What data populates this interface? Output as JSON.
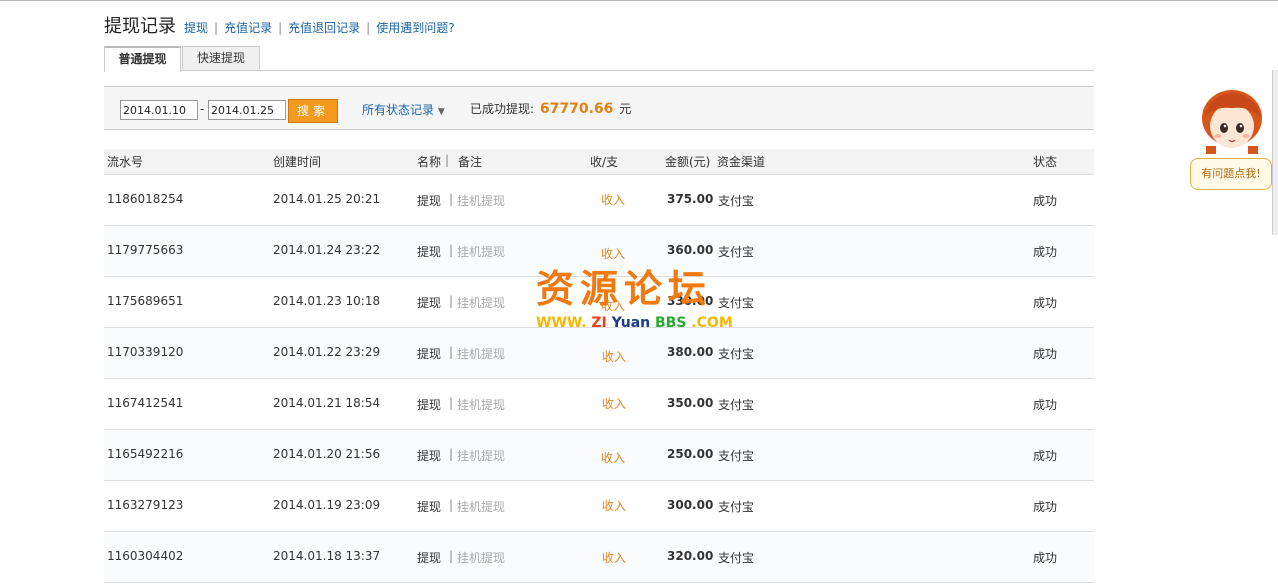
{
  "header": {
    "title": "提现记录",
    "links": [
      "提现",
      "充值记录",
      "充值退回记录",
      "使用遇到问题?"
    ]
  },
  "tabs": [
    "普通提现",
    "快速提现"
  ],
  "filter": {
    "start_date": "2014.01.10",
    "end_date": "2014.01.25",
    "dash": "-",
    "search_label": "搜索",
    "status_label": "所有状态记录",
    "total_label": "已成功提现:",
    "total_amount": "67770.66",
    "total_unit": "元"
  },
  "table": {
    "headers": {
      "serial": "流水号",
      "created": "创建时间",
      "name": "名称",
      "remark": "备注",
      "inout": "收/支",
      "amount": "金额(元)",
      "channel": "资金渠道",
      "status": "状态"
    },
    "rows": [
      {
        "serial": "1186018254",
        "created": "2014.01.25 20:21",
        "name": "提现",
        "remark": "挂机提现",
        "inout": "收入",
        "amount": "375.00",
        "channel": "支付宝",
        "status": "成功"
      },
      {
        "serial": "1179775663",
        "created": "2014.01.24 23:22",
        "name": "提现",
        "remark": "挂机提现",
        "inout": "收入",
        "amount": "360.00",
        "channel": "支付宝",
        "status": "成功"
      },
      {
        "serial": "1175689651",
        "created": "2014.01.23 10:18",
        "name": "提现",
        "remark": "挂机提现",
        "inout": "收入",
        "amount": "330.00",
        "channel": "支付宝",
        "status": "成功"
      },
      {
        "serial": "1170339120",
        "created": "2014.01.22 23:29",
        "name": "提现",
        "remark": "挂机提现",
        "inout": "收入",
        "amount": "380.00",
        "channel": "支付宝",
        "status": "成功"
      },
      {
        "serial": "1167412541",
        "created": "2014.01.21 18:54",
        "name": "提现",
        "remark": "挂机提现",
        "inout": "收入",
        "amount": "350.00",
        "channel": "支付宝",
        "status": "成功"
      },
      {
        "serial": "1165492216",
        "created": "2014.01.20 21:56",
        "name": "提现",
        "remark": "挂机提现",
        "inout": "收入",
        "amount": "250.00",
        "channel": "支付宝",
        "status": "成功"
      },
      {
        "serial": "1163279123",
        "created": "2014.01.19 23:09",
        "name": "提现",
        "remark": "挂机提现",
        "inout": "收入",
        "amount": "300.00",
        "channel": "支付宝",
        "status": "成功"
      },
      {
        "serial": "1160304402",
        "created": "2014.01.18 13:37",
        "name": "提现",
        "remark": "挂机提现",
        "inout": "收入",
        "amount": "320.00",
        "channel": "支付宝",
        "status": "成功"
      }
    ]
  },
  "help_widget": {
    "label": "有问题点我!"
  },
  "watermark": {
    "main": "资源论坛",
    "sub_www": "WWW.",
    "sub_zi": "ZI",
    "sub_yuan": "Yuan",
    "sub_bbs": "BBS",
    "sub_com": ".COM"
  },
  "colors": {
    "accent": "#f39a1e",
    "link": "#1a64a8",
    "income": "#e08a2a"
  }
}
